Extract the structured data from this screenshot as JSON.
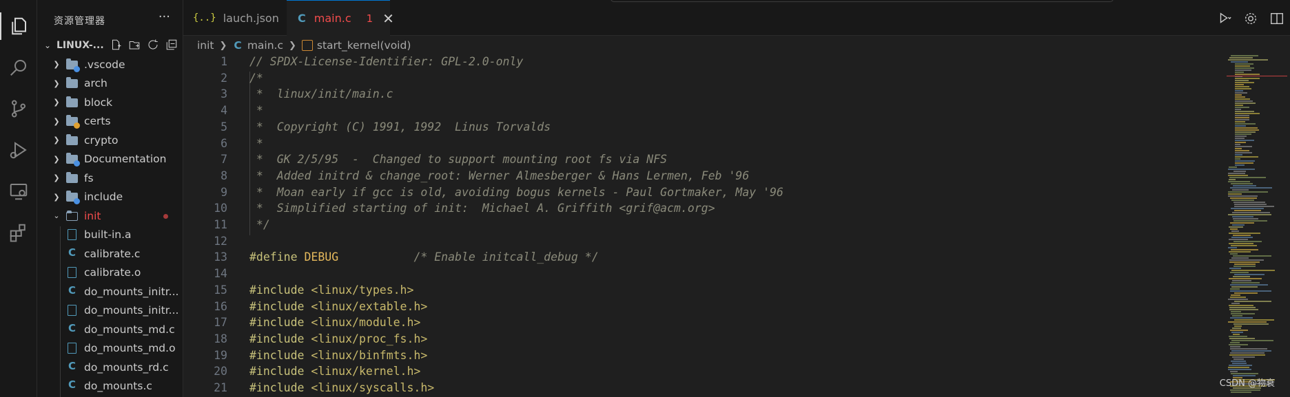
{
  "sidebar": {
    "title": "资源管理器",
    "root": "LINUX-...",
    "items": [
      {
        "label": ".vscode",
        "kind": "folder",
        "badge": "#4a90e2"
      },
      {
        "label": "arch",
        "kind": "folder"
      },
      {
        "label": "block",
        "kind": "folder"
      },
      {
        "label": "certs",
        "kind": "folder",
        "badge": "#e0a030"
      },
      {
        "label": "crypto",
        "kind": "folder"
      },
      {
        "label": "Documentation",
        "kind": "folder",
        "badge": "#4a90e2"
      },
      {
        "label": "fs",
        "kind": "folder"
      },
      {
        "label": "include",
        "kind": "folder",
        "badge": "#4a90e2"
      },
      {
        "label": "init",
        "kind": "folder-open"
      },
      {
        "label": "built-in.a",
        "kind": "file-doc"
      },
      {
        "label": "calibrate.c",
        "kind": "file-c"
      },
      {
        "label": "calibrate.o",
        "kind": "file-doc"
      },
      {
        "label": "do_mounts_initr...",
        "kind": "file-c"
      },
      {
        "label": "do_mounts_initr...",
        "kind": "file-doc"
      },
      {
        "label": "do_mounts_md.c",
        "kind": "file-c"
      },
      {
        "label": "do_mounts_md.o",
        "kind": "file-doc"
      },
      {
        "label": "do_mounts_rd.c",
        "kind": "file-c"
      },
      {
        "label": "do_mounts.c",
        "kind": "file-c"
      }
    ]
  },
  "tabs": {
    "tab1": "lauch.json",
    "tab1_icon": "{..}",
    "tab2": "main.c",
    "tab2_count": "1",
    "c_icon": "C",
    "close": "✕"
  },
  "breadcrumb": {
    "part1": "init",
    "part2": "main.c",
    "part3": "start_kernel(void)"
  },
  "code": [
    {
      "n": "1",
      "t": "// SPDX-License-Identifier: GPL-2.0-only"
    },
    {
      "n": "2",
      "t": "/*"
    },
    {
      "n": "3",
      "t": " *  linux/init/main.c"
    },
    {
      "n": "4",
      "t": " *"
    },
    {
      "n": "5",
      "t": " *  Copyright (C) 1991, 1992  Linus Torvalds"
    },
    {
      "n": "6",
      "t": " *"
    },
    {
      "n": "7",
      "t": " *  GK 2/5/95  -  Changed to support mounting root fs via NFS"
    },
    {
      "n": "8",
      "t": " *  Added initrd & change_root: Werner Almesberger & Hans Lermen, Feb '96"
    },
    {
      "n": "9",
      "t": " *  Moan early if gcc is old, avoiding bogus kernels - Paul Gortmaker, May '96"
    },
    {
      "n": "10",
      "t": " *  Simplified starting of init:  Michael A. Griffith <grif@acm.org>"
    },
    {
      "n": "11",
      "t": " */"
    },
    {
      "n": "12",
      "t": ""
    },
    {
      "n": "13",
      "t": "#define DEBUG          /* Enable initcall_debug */"
    },
    {
      "n": "14",
      "t": ""
    },
    {
      "n": "15",
      "t": "#include <linux/types.h>"
    },
    {
      "n": "16",
      "t": "#include <linux/extable.h>"
    },
    {
      "n": "17",
      "t": "#include <linux/module.h>"
    },
    {
      "n": "18",
      "t": "#include <linux/proc_fs.h>"
    },
    {
      "n": "19",
      "t": "#include <linux/binfmts.h>"
    },
    {
      "n": "20",
      "t": "#include <linux/kernel.h>"
    },
    {
      "n": "21",
      "t": "#include <linux/syscalls.h>"
    }
  ],
  "define": {
    "kw": "#define",
    "name": "DEBUG",
    "comment": "/* Enable initcall_debug */"
  },
  "watermark": "CSDN @物衰"
}
